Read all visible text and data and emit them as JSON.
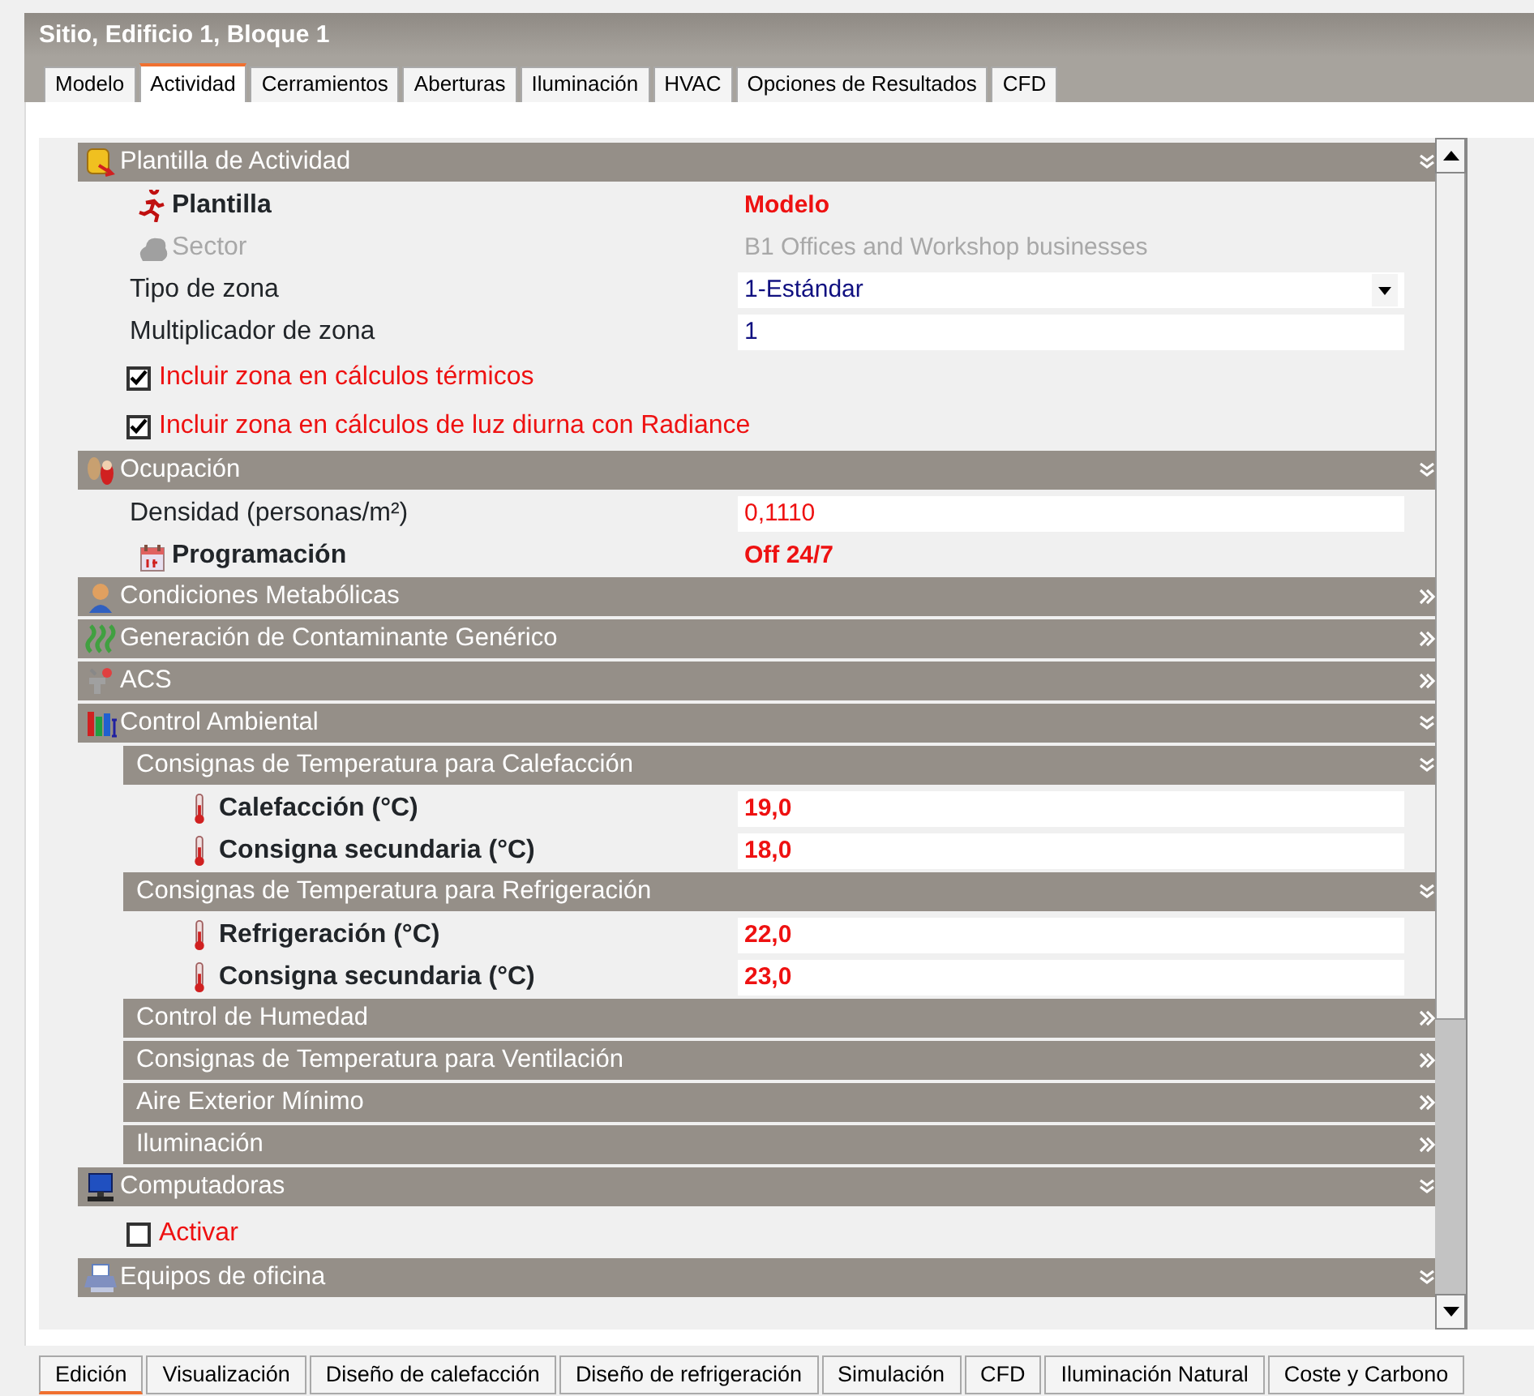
{
  "window": {
    "title": "Sitio, Edificio 1, Bloque 1"
  },
  "tabs": [
    {
      "label": "Modelo",
      "selected": false
    },
    {
      "label": "Actividad",
      "selected": true
    },
    {
      "label": "Cerramientos",
      "selected": false
    },
    {
      "label": "Aberturas",
      "selected": false
    },
    {
      "label": "Iluminación",
      "selected": false
    },
    {
      "label": "HVAC",
      "selected": false
    },
    {
      "label": "Opciones de Resultados",
      "selected": false
    },
    {
      "label": "CFD",
      "selected": false
    }
  ],
  "sections": [
    {
      "title": "Plantilla de Actividad",
      "expanded": true,
      "children": [
        {
          "kind": "link",
          "label": "Plantilla",
          "value": "Modelo",
          "disabled": false
        },
        {
          "kind": "link",
          "label": "Sector",
          "value": "B1 Offices and Workshop businesses",
          "disabled": true
        },
        {
          "kind": "dropdown",
          "label": "Tipo de zona",
          "value": "1-Estándar"
        },
        {
          "kind": "input",
          "label": "Multiplicador de zona",
          "value": "1",
          "highlighted": false
        },
        {
          "kind": "checkbox",
          "label": "Incluir zona en cálculos térmicos",
          "checked": true
        },
        {
          "kind": "checkbox",
          "label": "Incluir zona en cálculos de luz diurna con Radiance",
          "checked": true
        }
      ]
    },
    {
      "title": "Ocupación",
      "expanded": true,
      "children": [
        {
          "kind": "input",
          "label": "Densidad (personas/m²)",
          "value": "0,1110",
          "highlighted": true
        },
        {
          "kind": "link",
          "label": "Programación",
          "value": "Off 24/7",
          "disabled": false
        }
      ]
    },
    {
      "title": "Condiciones Metabólicas",
      "expanded": false
    },
    {
      "title": "Generación de Contaminante Genérico",
      "expanded": false
    },
    {
      "title": "ACS",
      "expanded": false
    },
    {
      "title": "Control Ambiental",
      "expanded": true,
      "children": [
        {
          "kind": "subsection",
          "title": "Consignas de Temperatura para Calefacción",
          "expanded": true,
          "children": [
            {
              "kind": "setpoint",
              "label": "Calefacción (°C)",
              "value": "19,0"
            },
            {
              "kind": "setpoint",
              "label": "Consigna secundaria (°C)",
              "value": "18,0"
            }
          ]
        },
        {
          "kind": "subsection",
          "title": "Consignas de Temperatura para Refrigeración",
          "expanded": true,
          "children": [
            {
              "kind": "setpoint",
              "label": "Refrigeración (°C)",
              "value": "22,0"
            },
            {
              "kind": "setpoint",
              "label": "Consigna secundaria (°C)",
              "value": "23,0"
            }
          ]
        },
        {
          "kind": "subsection",
          "title": "Control de Humedad",
          "expanded": false
        },
        {
          "kind": "subsection",
          "title": "Consignas de Temperatura para Ventilación",
          "expanded": false
        },
        {
          "kind": "subsection",
          "title": "Aire Exterior Mínimo",
          "expanded": false
        },
        {
          "kind": "subsection",
          "title": "Iluminación",
          "expanded": false
        }
      ]
    },
    {
      "title": "Computadoras",
      "expanded": true,
      "children": [
        {
          "kind": "checkbox",
          "label": "Activar",
          "checked": false
        }
      ]
    },
    {
      "title": "Equipos de oficina",
      "expanded": true
    }
  ],
  "bottom_tabs": [
    {
      "label": "Edición",
      "selected": true
    },
    {
      "label": "Visualización",
      "selected": false
    },
    {
      "label": "Diseño de calefacción",
      "selected": false
    },
    {
      "label": "Diseño de refrigeración",
      "selected": false
    },
    {
      "label": "Simulación",
      "selected": false
    },
    {
      "label": "CFD",
      "selected": false
    },
    {
      "label": "Iluminación Natural",
      "selected": false
    },
    {
      "label": "Coste y Carbono",
      "selected": false
    }
  ]
}
